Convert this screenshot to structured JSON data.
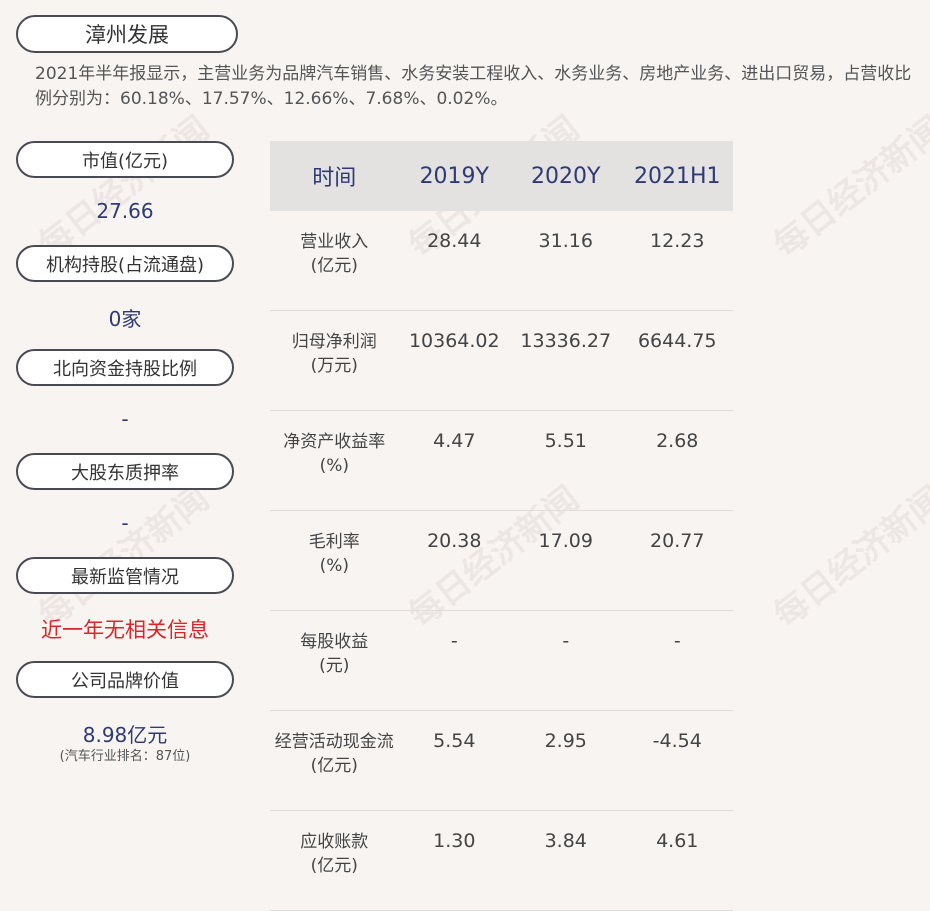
{
  "title": "漳州发展",
  "summary": "2021年半年报显示，主营业务为品牌汽车销售、水务安装工程收入、水务业务、房地产业务、进出口贸易，占营收比例分别为：60.18%、17.57%、12.66%、7.68%、0.02%。",
  "side": [
    {
      "label": "市值(亿元)",
      "value": "27.66"
    },
    {
      "label": "机构持股(占流通盘)",
      "value": "0家"
    },
    {
      "label": "北向资金持股比例",
      "value": "-"
    },
    {
      "label": "大股东质押率",
      "value": "-"
    },
    {
      "label": "最新监管情况",
      "value": "近一年无相关信息"
    },
    {
      "label": "公司品牌价值",
      "value": "8.98亿元",
      "sub": "(汽车行业排名：87位)"
    }
  ],
  "table": {
    "headers": [
      "时间",
      "2019Y",
      "2020Y",
      "2021H1"
    ],
    "rows": [
      {
        "label": "营业收入",
        "unit": "(亿元)",
        "values": [
          "28.44",
          "31.16",
          "12.23"
        ]
      },
      {
        "label": "归母净利润",
        "unit": "(万元)",
        "values": [
          "10364.02",
          "13336.27",
          "6644.75"
        ]
      },
      {
        "label": "净资产收益率",
        "unit": "(%)",
        "values": [
          "4.47",
          "5.51",
          "2.68"
        ]
      },
      {
        "label": "毛利率",
        "unit": "(%)",
        "values": [
          "20.38",
          "17.09",
          "20.77"
        ]
      },
      {
        "label": "每股收益",
        "unit": "(元)",
        "values": [
          "-",
          "-",
          "-"
        ]
      },
      {
        "label": "经营活动现金流",
        "unit": "(亿元)",
        "values": [
          "5.54",
          "2.95",
          "-4.54"
        ]
      },
      {
        "label": "应收账款",
        "unit": "(亿元)",
        "values": [
          "1.30",
          "3.84",
          "4.61"
        ]
      }
    ]
  },
  "watermark": "每日经济新闻"
}
